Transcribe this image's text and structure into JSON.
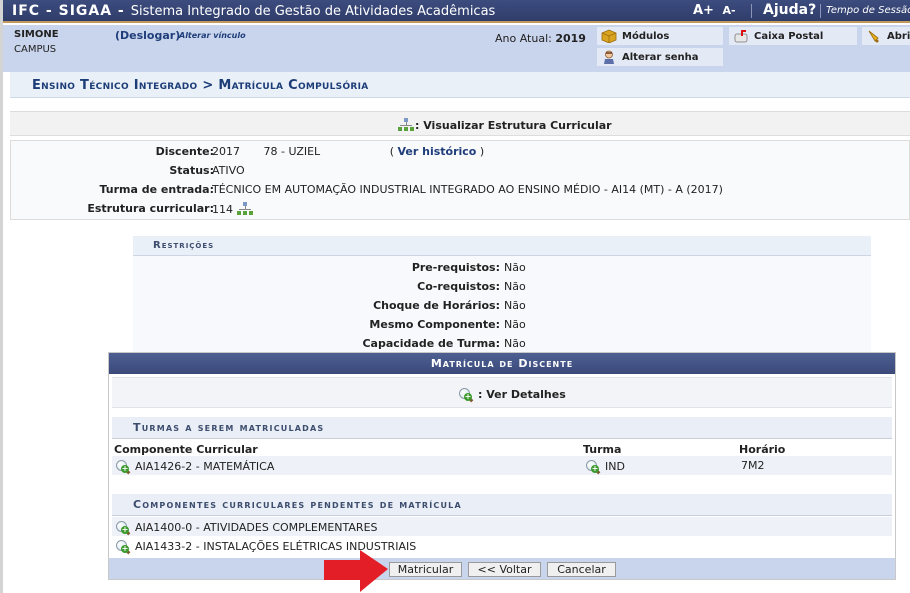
{
  "header": {
    "system_short": "IFC - SIGAA -",
    "system_full": "Sistema Integrado de Gestão de Atividades Acadêmicas",
    "font_increase": "A+",
    "font_decrease": "A-",
    "help": "Ajuda?",
    "session_label": "Tempo de Sessão:"
  },
  "user": {
    "name": "SIMONE",
    "campus": "CAMPUS",
    "logout": "(Deslogar)",
    "change_link": "Alterar vínculo",
    "year_label": "Ano Atual:",
    "year_value": "2019"
  },
  "menu": {
    "modules": {
      "label": "Módulos",
      "icon": "modules-box-icon"
    },
    "mailbox": {
      "label": "Caixa Postal",
      "icon": "mailbox-icon"
    },
    "open_ticket": {
      "label": "Abrir",
      "icon": "bell-icon"
    },
    "change_password": {
      "label": "Alterar senha",
      "icon": "user-icon"
    }
  },
  "breadcrumb": "Ensino Técnico Integrado > Matrícula Compulsória",
  "legend_structure": ": Visualizar Estrutura Curricular",
  "student": {
    "discente_label": "Discente:",
    "discente_year": "2017",
    "discente_id": "78 - UZIEL",
    "history_open": "(",
    "history_link": "Ver histórico",
    "history_close": ")",
    "status_label": "Status:",
    "status_value": "ATIVO",
    "turma_label": "Turma de entrada:",
    "turma_value": "TÉCNICO EM AUTOMAÇÃO INDUSTRIAL INTEGRADO AO ENSINO MÉDIO - AI14 (MT) - A (2017)",
    "estrutura_label": "Estrutura curricular:",
    "estrutura_value": "114"
  },
  "restrictions": {
    "title": "Restrições",
    "items": [
      {
        "label": "Pre-requistos:",
        "value": "Não"
      },
      {
        "label": "Co-requistos:",
        "value": "Não"
      },
      {
        "label": "Choque de Horários:",
        "value": "Não"
      },
      {
        "label": "Mesmo Componente:",
        "value": "Não"
      },
      {
        "label": "Capacidade de Turma:",
        "value": "Não"
      }
    ]
  },
  "enrollment": {
    "title": "Matrícula de Discente",
    "legend_details": ": Ver Detalhes",
    "to_enroll_title": "Turmas a serem matriculadas",
    "columns": [
      "Componente Curricular",
      "Turma",
      "Horário"
    ],
    "to_enroll": [
      {
        "component": "AIA1426-2 - MATEMÁTICA",
        "turma": "IND",
        "horario": "7M2"
      }
    ],
    "pending_title": "Componentes curriculares pendentes de matrícula",
    "pending": [
      "AIA1400-0 - ATIVIDADES COMPLEMENTARES",
      "AIA1433-2 - INSTALAÇÕES ELÉTRICAS INDUSTRIAIS"
    ],
    "buttons": {
      "submit": "Matricular",
      "back": "<< Voltar",
      "cancel": "Cancelar"
    }
  },
  "colors": {
    "header_bg": "#35446f",
    "header_accent": "#c39a5e",
    "info_band": "#c8d5ec",
    "link_blue": "#1f3d7a",
    "annotation_arrow": "#e41e26"
  }
}
